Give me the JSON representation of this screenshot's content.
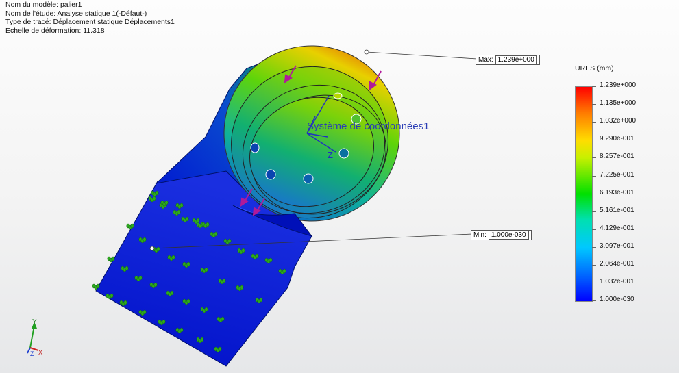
{
  "info": {
    "lines": [
      "Nom du modèle: palier1",
      "Nom de l'étude: Analyse statique 1(-Défaut-)",
      "Type de tracé: Déplacement statique Déplacements1",
      "Echelle de déformation: 11.318"
    ]
  },
  "callouts": {
    "max_label": "Max:",
    "max_value": "1.239e+000",
    "min_label": "Min:",
    "min_value": "1.000e-030"
  },
  "legend": {
    "title": "URES (mm)",
    "ticks": [
      "1.239e+000",
      "1.135e+000",
      "1.032e+000",
      "9.290e-001",
      "8.257e-001",
      "7.225e-001",
      "6.193e-001",
      "5.161e-001",
      "4.129e-001",
      "3.097e-001",
      "2.064e-001",
      "1.032e-001",
      "1.000e-030"
    ],
    "colors": {
      "max": "#ff0000",
      "min": "#0000ff"
    }
  },
  "model": {
    "coordinate_system_label": "Système de coordonnées1",
    "axis_z": "Z",
    "axis_x_small": "X"
  },
  "triad": {
    "x": "X",
    "y": "Y",
    "z": "Z"
  },
  "icons": [
    "fixture-arrow-icon",
    "load-arrow-icon",
    "triad-icon",
    "probe-point-icon"
  ]
}
